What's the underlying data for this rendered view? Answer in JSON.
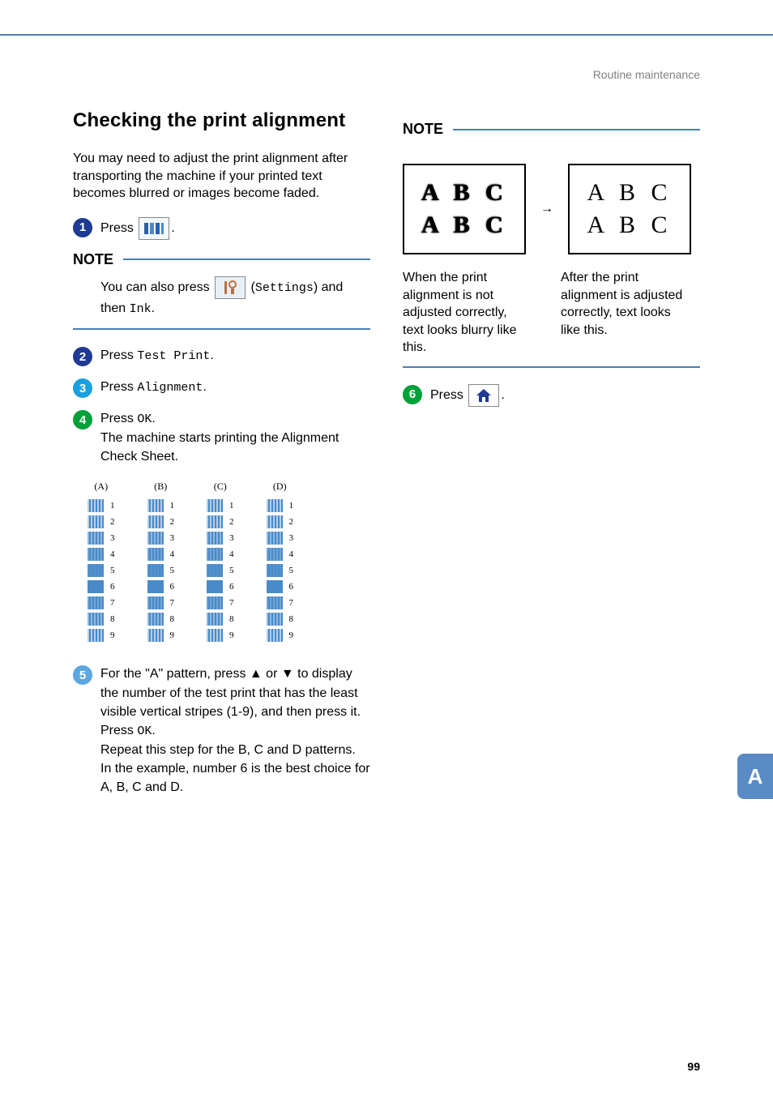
{
  "header": {
    "section": "Routine maintenance"
  },
  "side_tab": "A",
  "page_number": "99",
  "title": "Checking the print alignment",
  "intro": "You may need to adjust the print alignment after transporting the machine if your printed text becomes blurred or images become faded.",
  "steps": {
    "s1_press": "Press ",
    "s2": "Press ",
    "s2_cmd": "Test Print",
    "s3": "Press ",
    "s3_cmd": "Alignment",
    "s4a": "Press ",
    "s4a_cmd": "OK",
    "s4b": "The machine starts printing the Alignment Check Sheet.",
    "s5a": "For the \"A\" pattern, press ▲ or ▼ to display the number of the test print that has the least visible vertical stripes (1-9), and then press it.",
    "s5b": "Press ",
    "s5b_cmd": "OK",
    "s5c": "Repeat this step for the B, C and D patterns.",
    "s5d": "In the example, number 6 is the best choice for A, B, C and D.",
    "s6": "Press "
  },
  "note1": {
    "label": "NOTE",
    "pre": "You can also press ",
    "settings": "Settings",
    "post": ") and then ",
    "ink": "Ink"
  },
  "note2": {
    "label": "NOTE",
    "bad_caption": "When the print alignment is not adjusted correctly, text looks blurry like this.",
    "good_caption": "After the print alignment is adjusted correctly, text looks like this.",
    "sample1": "A B C",
    "sample2": "A B C"
  },
  "chart_data": {
    "type": "table",
    "title": "Alignment Check Sheet",
    "columns": [
      "(A)",
      "(B)",
      "(C)",
      "(D)"
    ],
    "rows": [
      1,
      2,
      3,
      4,
      5,
      6,
      7,
      8,
      9
    ],
    "best_choice": 6,
    "note": "Each cell is a printed stripe swatch; number 6 shows the least visible vertical stripes in every column in this example."
  }
}
